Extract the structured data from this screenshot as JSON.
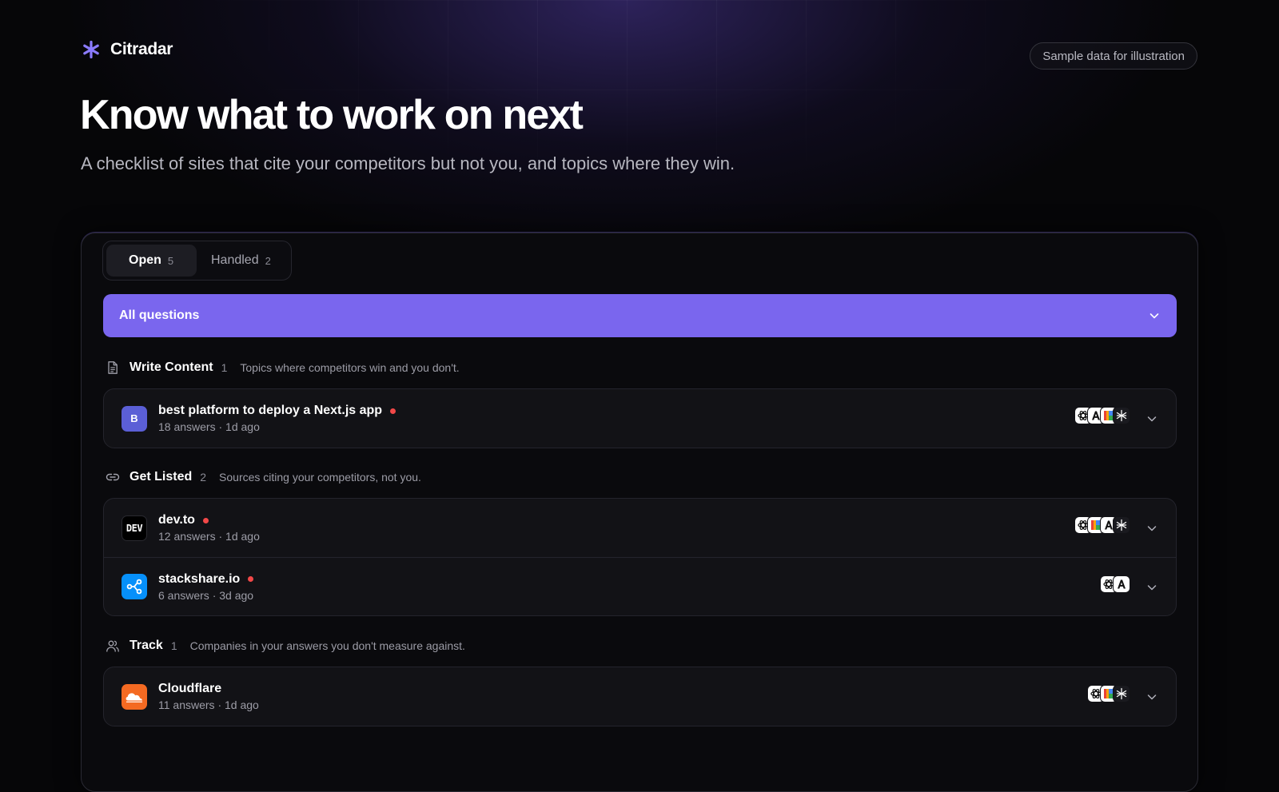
{
  "brand": {
    "name": "Citradar",
    "accent": "#8b7bff"
  },
  "badge": "Sample data for illustration",
  "hero": {
    "title": "Know what to work on next",
    "subtitle": "A checklist of sites that cite your competitors but not you, and topics where they win."
  },
  "tabs": [
    {
      "label": "Open",
      "count": "5",
      "active": true
    },
    {
      "label": "Handled",
      "count": "2",
      "active": false
    }
  ],
  "filter": {
    "label": "All questions",
    "color": "#7a66ee"
  },
  "sections": {
    "write": {
      "title": "Write Content",
      "count": "1",
      "description": "Topics where competitors win and you don't.",
      "icon": "document-icon",
      "items": [
        {
          "avatar": "B",
          "avatar_color": "#5b5fd6",
          "title": "best platform to deploy a Next.js app",
          "meta": "18 answers · 1d ago",
          "new": true,
          "engines": [
            "chatgpt-icon",
            "anthropic-icon",
            "gemini-icon",
            "perplexity-icon"
          ]
        }
      ]
    },
    "listed": {
      "title": "Get Listed",
      "count": "2",
      "description": "Sources citing your competitors, not you.",
      "icon": "link-icon",
      "items": [
        {
          "avatar": "DEV",
          "avatar_color": "#000000",
          "title": "dev.to",
          "meta": "12 answers · 1d ago",
          "new": true,
          "engines": [
            "chatgpt-icon",
            "gemini-icon",
            "anthropic-icon",
            "perplexity-icon"
          ]
        },
        {
          "avatar": "stackshare-icon",
          "avatar_color": "#0690fa",
          "title": "stackshare.io",
          "meta": "6 answers · 3d ago",
          "new": true,
          "engines": [
            "chatgpt-icon",
            "anthropic-icon"
          ]
        }
      ]
    },
    "track": {
      "title": "Track",
      "count": "1",
      "description": "Companies in your answers you don't measure against.",
      "icon": "users-icon",
      "items": [
        {
          "avatar": "cloudflare-icon",
          "avatar_color": "#f38020",
          "title": "Cloudflare",
          "meta": "11 answers · 1d ago",
          "new": false,
          "engines": [
            "chatgpt-icon",
            "gemini-icon",
            "perplexity-icon"
          ]
        }
      ]
    }
  }
}
